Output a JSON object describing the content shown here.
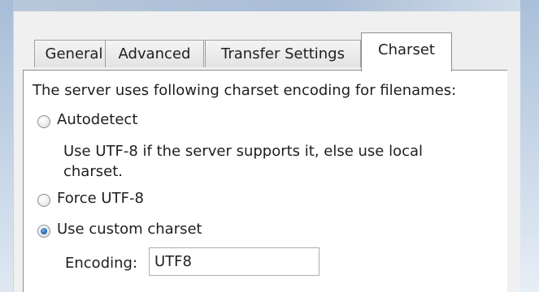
{
  "tabs": [
    {
      "label": "General"
    },
    {
      "label": "Advanced"
    },
    {
      "label": "Transfer Settings"
    },
    {
      "label": "Charset",
      "active": true
    }
  ],
  "charset": {
    "description": "The server uses following charset encoding for filenames:",
    "options": [
      {
        "label": "Autodetect",
        "checked": false
      },
      {
        "label": "Force UTF-8",
        "checked": false
      },
      {
        "label": "Use custom charset",
        "checked": true
      }
    ],
    "autodetect_hint_line1": "Use UTF-8 if the server supports it, else use local",
    "autodetect_hint_line2": "charset.",
    "encoding_label": "Encoding:",
    "encoding_value": "UTF8"
  },
  "colors": {
    "radio_checked": "#2a6fc0",
    "panel_background": "#ffffff",
    "window_frame": "#a9bdd6"
  }
}
